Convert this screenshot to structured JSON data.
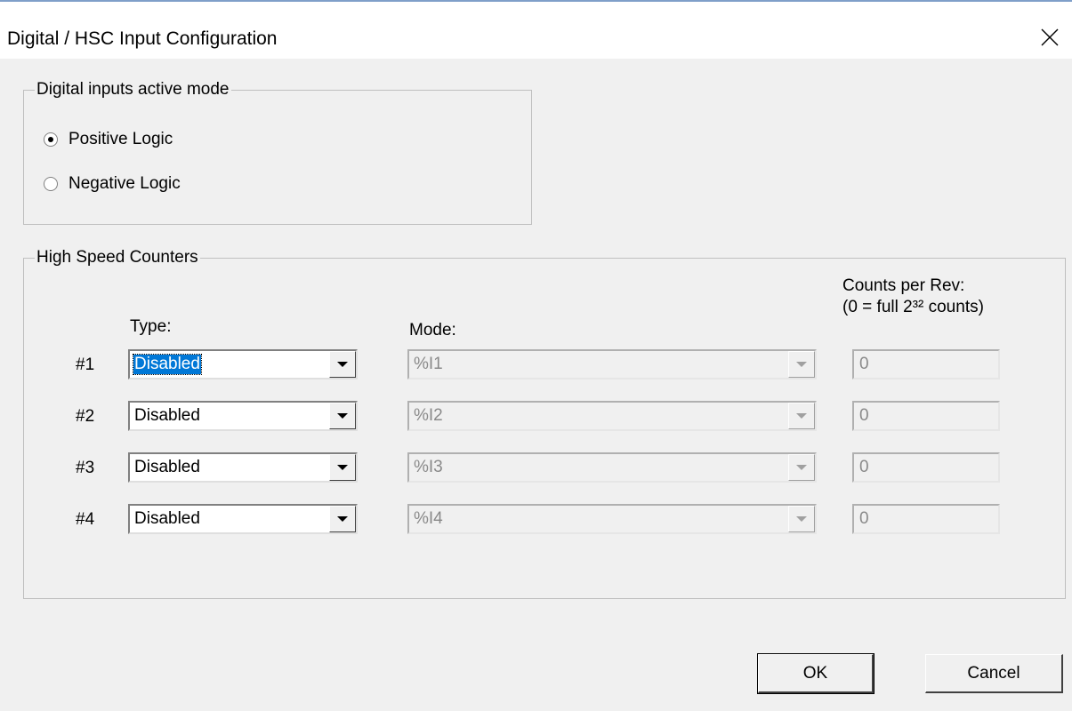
{
  "window": {
    "title": "Digital / HSC Input Configuration",
    "close_icon": "close-icon"
  },
  "digital_inputs": {
    "legend": "Digital inputs active mode",
    "options": [
      {
        "label": "Positive Logic",
        "checked": true
      },
      {
        "label": "Negative Logic",
        "checked": false
      }
    ]
  },
  "hsc": {
    "legend": "High Speed Counters",
    "headers": {
      "type": "Type:",
      "mode": "Mode:",
      "counts_line1": "Counts per Rev:",
      "counts_line2": "(0 = full 2³² counts)"
    },
    "rows": [
      {
        "label": "#1",
        "type": "Disabled",
        "mode": "%I1",
        "counts": "0"
      },
      {
        "label": "#2",
        "type": "Disabled",
        "mode": "%I2",
        "counts": "0"
      },
      {
        "label": "#3",
        "type": "Disabled",
        "mode": "%I3",
        "counts": "0"
      },
      {
        "label": "#4",
        "type": "Disabled",
        "mode": "%I4",
        "counts": "0"
      }
    ]
  },
  "buttons": {
    "ok": "OK",
    "cancel": "Cancel"
  }
}
